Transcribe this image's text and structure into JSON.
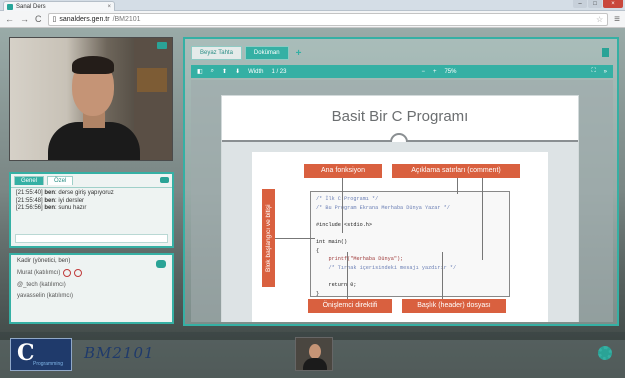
{
  "browser": {
    "tab_title": "Sanal Ders",
    "url_host": "sanalders.gen.tr",
    "url_path": "/BM2101"
  },
  "chat": {
    "tabs": [
      "Genel",
      "Özel"
    ],
    "messages": [
      {
        "time": "[21:55:40]",
        "user": "ben",
        "text": ": derse giriş yapıyoruz"
      },
      {
        "time": "[21:55:48]",
        "user": "ben",
        "text": ": iyi dersler"
      },
      {
        "time": "[21:56:56]",
        "user": "ben",
        "text": ": sunu hazır"
      }
    ]
  },
  "users": {
    "owner": "Kadir (yönetici, ben)",
    "list": [
      "Murat (katılımcı)",
      "@_tech (katılımcı)",
      "yavasselin (katılımcı)"
    ]
  },
  "board": {
    "tabs": [
      "Beyaz Tahta",
      "Doküman"
    ],
    "add": "+",
    "toolbar": {
      "width_label": "Width",
      "page": "1 / 23",
      "zoom": "75%"
    }
  },
  "slide": {
    "title": "Basit Bir C Programı",
    "labels": {
      "main": "Ana fonksiyon",
      "comment": "Açıklama satırları (comment)",
      "block": "Blok başlangıcı ve bitişi",
      "preprocessor": "Önişlemci direktifi",
      "header": "Başlık (header) dosyası"
    },
    "code": [
      "/* İlk C Programı */",
      "/* Bu Program Ekrana Merhaba Dünya Yazar */",
      "",
      "#include <stdio.h>",
      "",
      "int main()",
      "{",
      "    printf(\"Merhaba Dünya\");",
      "    /* Tırnak içerisindeki mesajı yazdırır */",
      "",
      "    return 0;",
      "}"
    ]
  },
  "course": {
    "logo_letter": "C",
    "logo_sub": "Programming",
    "code": "BM2101"
  },
  "colors": {
    "accent": "#35b0a4",
    "label": "#d9603f",
    "logo": "#1f3a6b"
  }
}
